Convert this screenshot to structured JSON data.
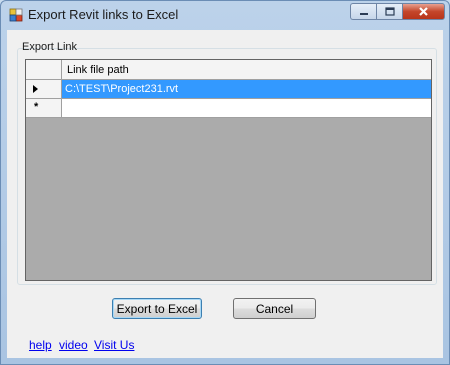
{
  "window": {
    "title": "Export Revit links to Excel",
    "icon": "revit-app-icon",
    "caption_buttons": [
      "minimize",
      "maximize",
      "close"
    ]
  },
  "group": {
    "label": "Export Link"
  },
  "grid": {
    "columns": [
      "Link file path"
    ],
    "rows": [
      {
        "indicator": "current-row-arrow",
        "value": "C:\\TEST\\Project231.rvt",
        "selected": true
      },
      {
        "indicator": "*",
        "value": "",
        "selected": false
      }
    ]
  },
  "buttons": {
    "export_label": "Export to Excel",
    "cancel_label": "Cancel"
  },
  "links": {
    "help": "help",
    "video": "video",
    "visit": "Visit Us"
  },
  "colors": {
    "selection": "#3399ff",
    "grid_background": "#ababab",
    "link": "#0000ee"
  }
}
